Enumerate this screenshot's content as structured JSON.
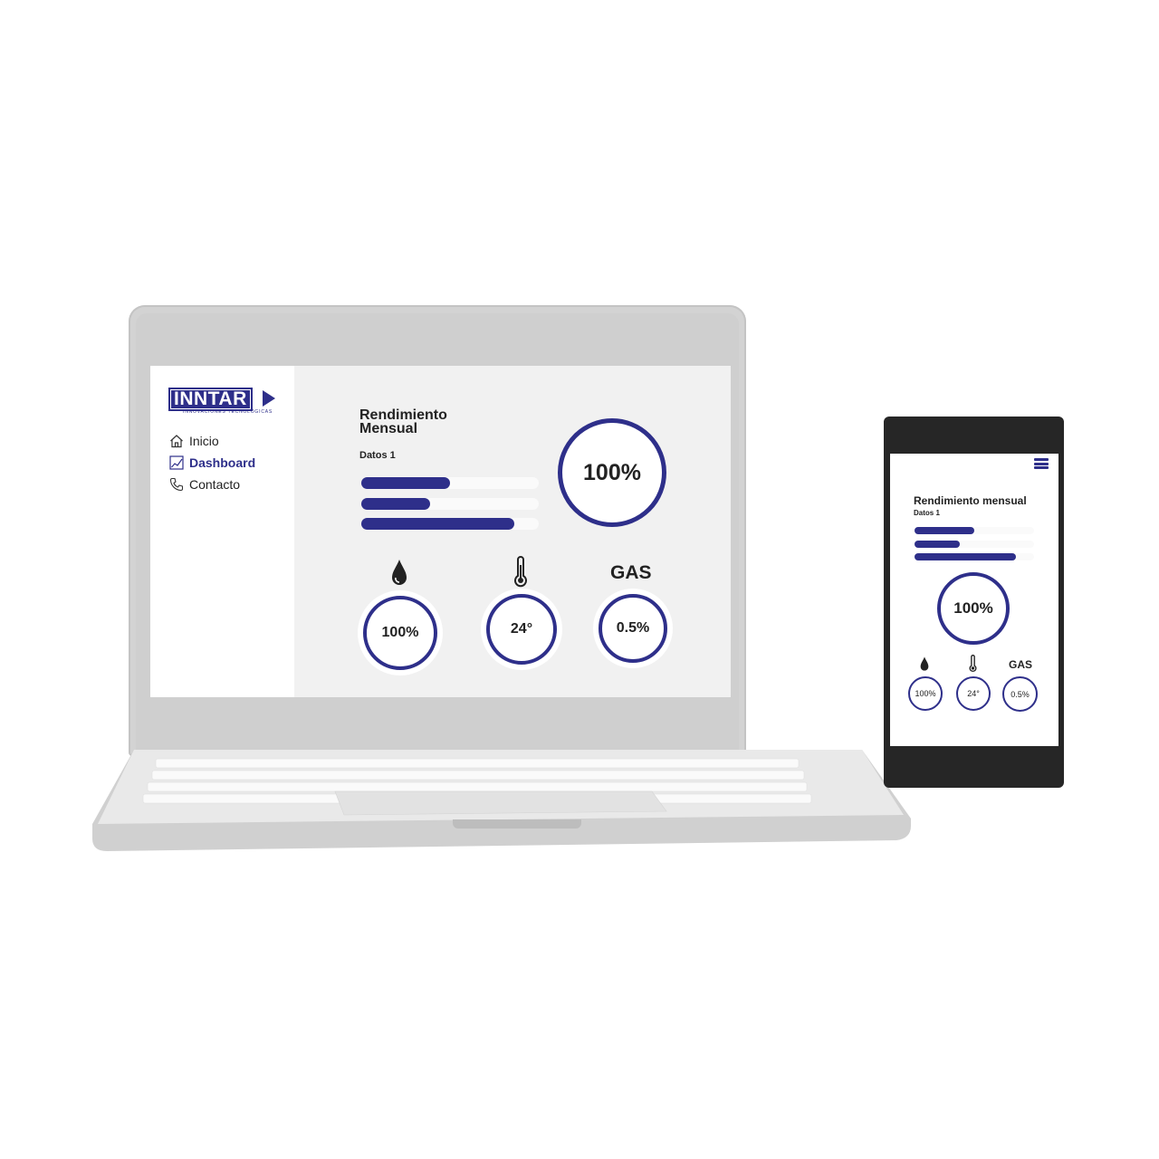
{
  "brand": {
    "name": "INNTAR",
    "tagline": "INNOVACIONES TECNOLÓGICAS",
    "accent_color": "#2e2f8a"
  },
  "laptop": {
    "nav": [
      {
        "label": "Inicio",
        "icon": "home-icon",
        "active": false
      },
      {
        "label": "Dashboard",
        "icon": "chart-icon",
        "active": true
      },
      {
        "label": "Contacto",
        "icon": "phone-icon",
        "active": false
      }
    ],
    "title": "Rendimiento Mensual",
    "datos_label": "Datos 1",
    "bars": [
      0.5,
      0.39,
      0.86
    ],
    "main_value": "100%",
    "sensors": [
      {
        "icon": "water-drop-icon",
        "value": "100%"
      },
      {
        "icon": "thermometer-icon",
        "value": "24°"
      },
      {
        "label": "GAS",
        "value": "0.5%"
      }
    ]
  },
  "phone": {
    "menu_icon": "hamburger-menu-icon",
    "title": "Rendimiento mensual",
    "datos_label": "Datos 1",
    "bars": [
      0.5,
      0.38,
      0.85
    ],
    "main_value": "100%",
    "sensors": [
      {
        "icon": "water-drop-icon",
        "value": "100%"
      },
      {
        "icon": "thermometer-icon",
        "value": "24°"
      },
      {
        "label": "GAS",
        "value": "0.5%"
      }
    ]
  }
}
